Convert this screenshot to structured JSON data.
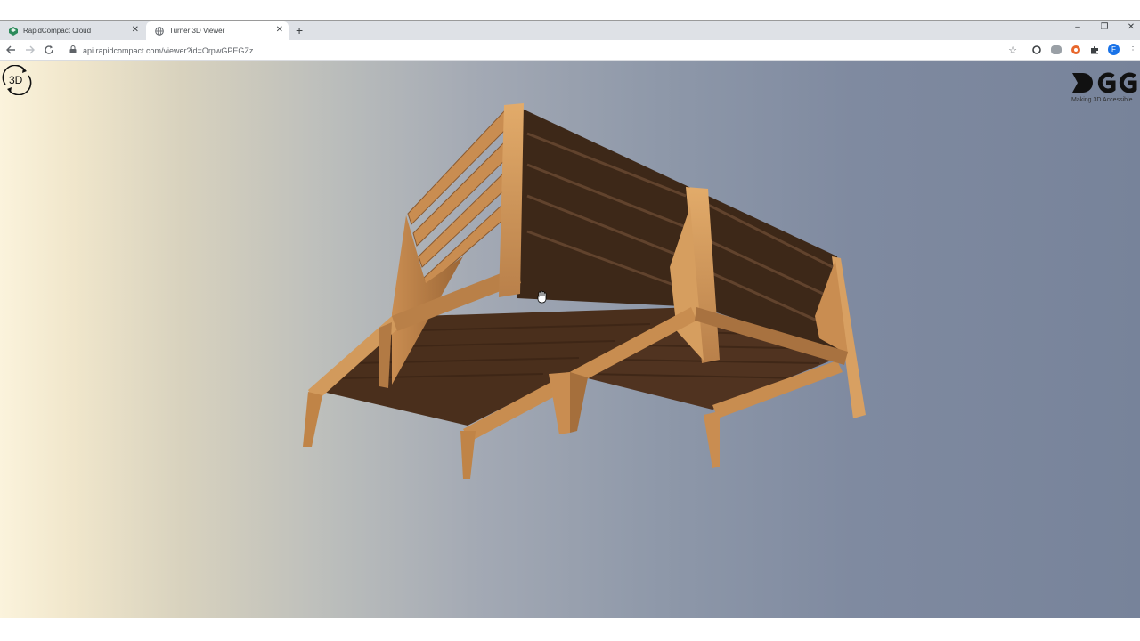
{
  "browser": {
    "tabs": [
      {
        "title": "RapidCompact Cloud",
        "active": false
      },
      {
        "title": "Turner 3D Viewer",
        "active": true
      }
    ],
    "address": "api.rapidcompact.com/viewer?id=OrpwGPEGZz",
    "profile_initial": "F"
  },
  "viewer": {
    "mode_badge": "3D",
    "logo_tagline": "Making 3D Accessible.",
    "model": "two wooden slatted lounge chairs viewed from below"
  },
  "colors": {
    "tab_strip": "#dee1e6",
    "wood_light": "#d49a5a",
    "wood_mid": "#a5703c",
    "wood_dark": "#4a2f1c",
    "profile_badge": "#1a73e8"
  }
}
